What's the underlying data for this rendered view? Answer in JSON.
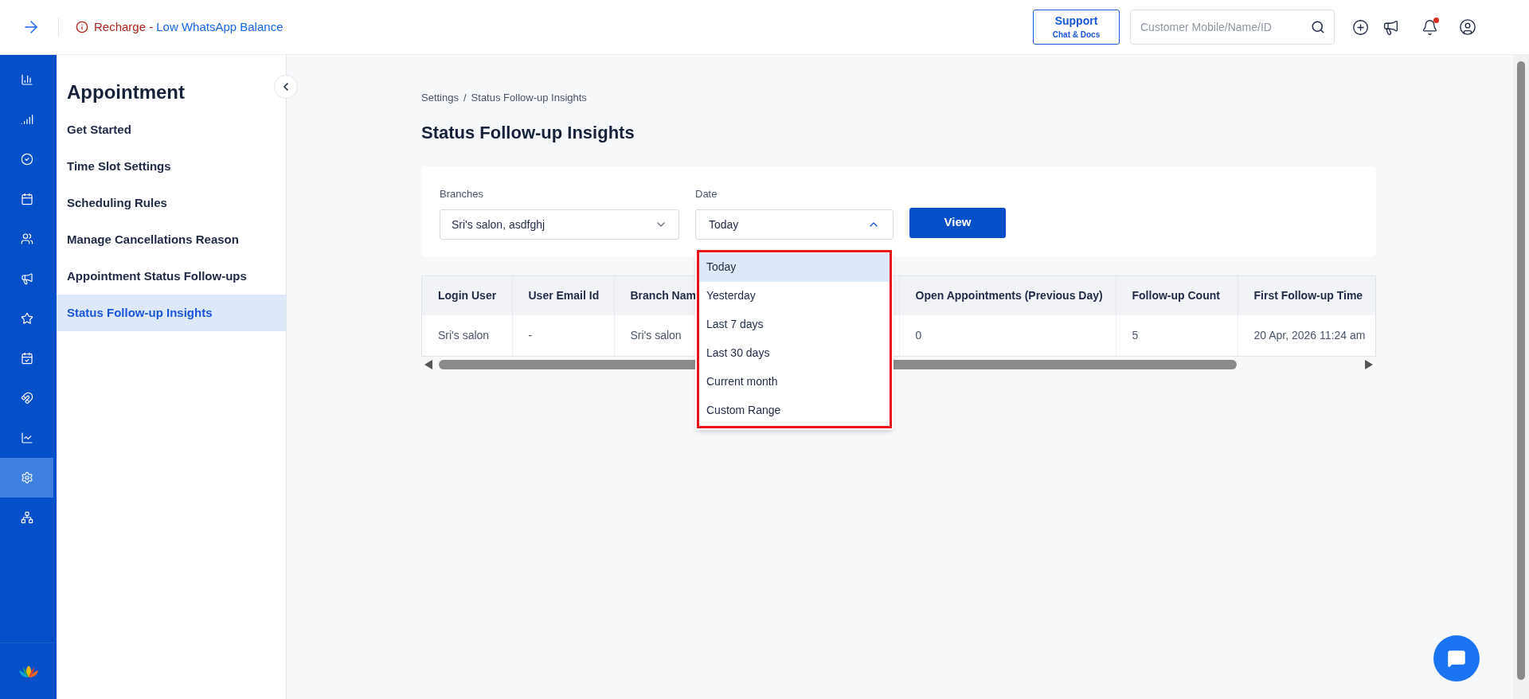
{
  "top_bar": {
    "alert": {
      "label": "Recharge",
      "separator": " - ",
      "link": "Low WhatsApp Balance"
    },
    "support": {
      "title": "Support",
      "subtitle": "Chat & Docs"
    },
    "search": {
      "placeholder": "Customer Mobile/Name/ID"
    },
    "notification_dot": true
  },
  "icon_rail": [
    {
      "selected": false
    },
    {
      "selected": false
    },
    {
      "selected": false
    },
    {
      "selected": false
    },
    {
      "selected": false
    },
    {
      "selected": false
    },
    {
      "selected": false
    },
    {
      "selected": false
    },
    {
      "selected": false
    },
    {
      "selected": false
    },
    {
      "selected": true
    },
    {
      "selected": false
    }
  ],
  "menu": {
    "title": "Appointment",
    "items": [
      {
        "label": "Get Started",
        "selected": false
      },
      {
        "label": "Time Slot Settings",
        "selected": false
      },
      {
        "label": "Scheduling Rules",
        "selected": false
      },
      {
        "label": "Manage Cancellations Reason",
        "selected": false
      },
      {
        "label": "Appointment Status Follow-ups",
        "selected": false
      },
      {
        "label": "Status Follow-up Insights",
        "selected": true
      }
    ]
  },
  "breadcrumb": [
    "Settings",
    "Status Follow-up Insights"
  ],
  "breadcrumb_separator": "/",
  "title": "Status Follow-up Insights",
  "filters": {
    "branches": {
      "label": "Branches",
      "value": "Sri's salon, asdfghj"
    },
    "date": {
      "label": "Date",
      "value": "Today",
      "expanded": true,
      "options": [
        {
          "label": "Today",
          "selected": true
        },
        {
          "label": "Yesterday",
          "selected": false
        },
        {
          "label": "Last 7 days",
          "selected": false
        },
        {
          "label": "Last 30 days",
          "selected": false
        },
        {
          "label": "Current month",
          "selected": false
        },
        {
          "label": "Custom Range",
          "selected": false
        }
      ]
    },
    "button": "View"
  },
  "table": {
    "columns": [
      "Login User",
      "User Email Id",
      "Branch Nam",
      "Open Appointments (Previous Day)",
      "Follow-up Count",
      "First Follow-up Time"
    ],
    "rows": [
      [
        "Sri's salon",
        "-",
        "Sri's salon",
        "0",
        "5",
        "20 Apr, 2026 11:24 am"
      ]
    ]
  }
}
